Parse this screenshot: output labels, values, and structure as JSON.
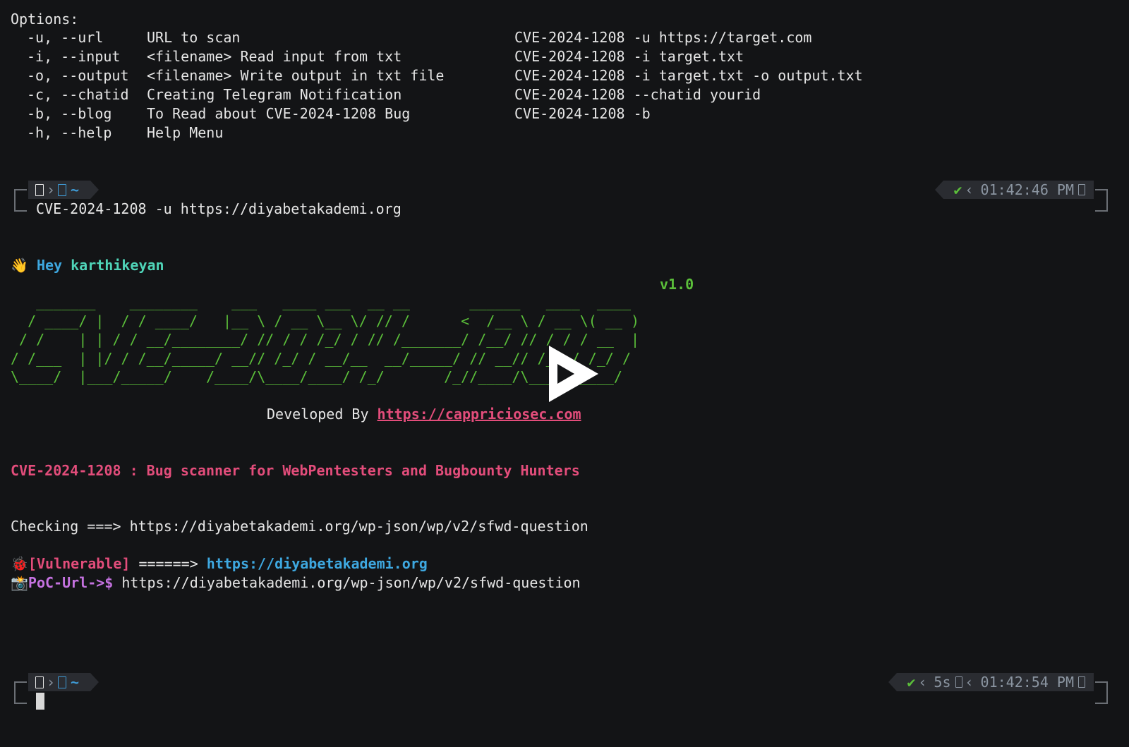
{
  "options": {
    "header": "Options:",
    "rows": [
      {
        "flag": "-u, --url",
        "desc": "URL to scan",
        "example": "CVE-2024-1208 -u https://target.com"
      },
      {
        "flag": "-i, --input",
        "desc": "<filename> Read input from txt",
        "example": "CVE-2024-1208 -i target.txt"
      },
      {
        "flag": "-o, --output",
        "desc": "<filename> Write output in txt file",
        "example": "CVE-2024-1208 -i target.txt -o output.txt"
      },
      {
        "flag": "-c, --chatid",
        "desc": "Creating Telegram Notification",
        "example": "CVE-2024-1208 --chatid yourid"
      },
      {
        "flag": "-b, --blog",
        "desc": "To Read about CVE-2024-1208 Bug",
        "example": "CVE-2024-1208 -b"
      },
      {
        "flag": "-h, --help",
        "desc": "Help Menu",
        "example": ""
      }
    ]
  },
  "prompt1": {
    "dir": "~",
    "check": "✔",
    "time": "01:42:46 PM",
    "command": "CVE-2024-1208 -u https://diyabetakademi.org"
  },
  "greeting": {
    "hey": "Hey",
    "name": "karthikeyan"
  },
  "version": "v1.0",
  "ascii_art": "   _______    ________    ___   ____ ___  __ __       ______   ____  ____ \n  / ____/ |  / / ____/   |__ \\ / __ \\__ \\/ // /      <  /__ \\ / __ \\( __ )\n / /    | | / / __/________/ // / / /_/ / // /_______/ /__/ // / / / __  |\n/ /___  | |/ / /__/_____/ __// /_/ / __/__  __/_____/ // __// /_/ / /_/ / \n\\____/  |___/_____/    /____/\\____/____/ /_/       /_//____/\\____/\\____/  ",
  "developed": {
    "label": "Developed By ",
    "link": "https://cappriciosec.com"
  },
  "tagline": "CVE-2024-1208 : Bug scanner for WebPentesters and Bugbounty Hunters",
  "checking": "Checking ===> https://diyabetakademi.org/wp-json/wp/v2/sfwd-question",
  "vulnerable": {
    "tag": "[Vulnerable]",
    "arrow": " ======> ",
    "url": "https://diyabetakademi.org"
  },
  "poc": {
    "label": "PoC-Url->$",
    "url": " https://diyabetakademi.org/wp-json/wp/v2/sfwd-question"
  },
  "prompt2": {
    "dir": "~",
    "check": "✔",
    "duration": "5s",
    "time": "01:42:54 PM"
  },
  "colors": {
    "background": "#131416",
    "green": "#5bbf3a",
    "pink": "#e34d7b",
    "blue": "#3ea8e0",
    "purple": "#c572e0"
  }
}
